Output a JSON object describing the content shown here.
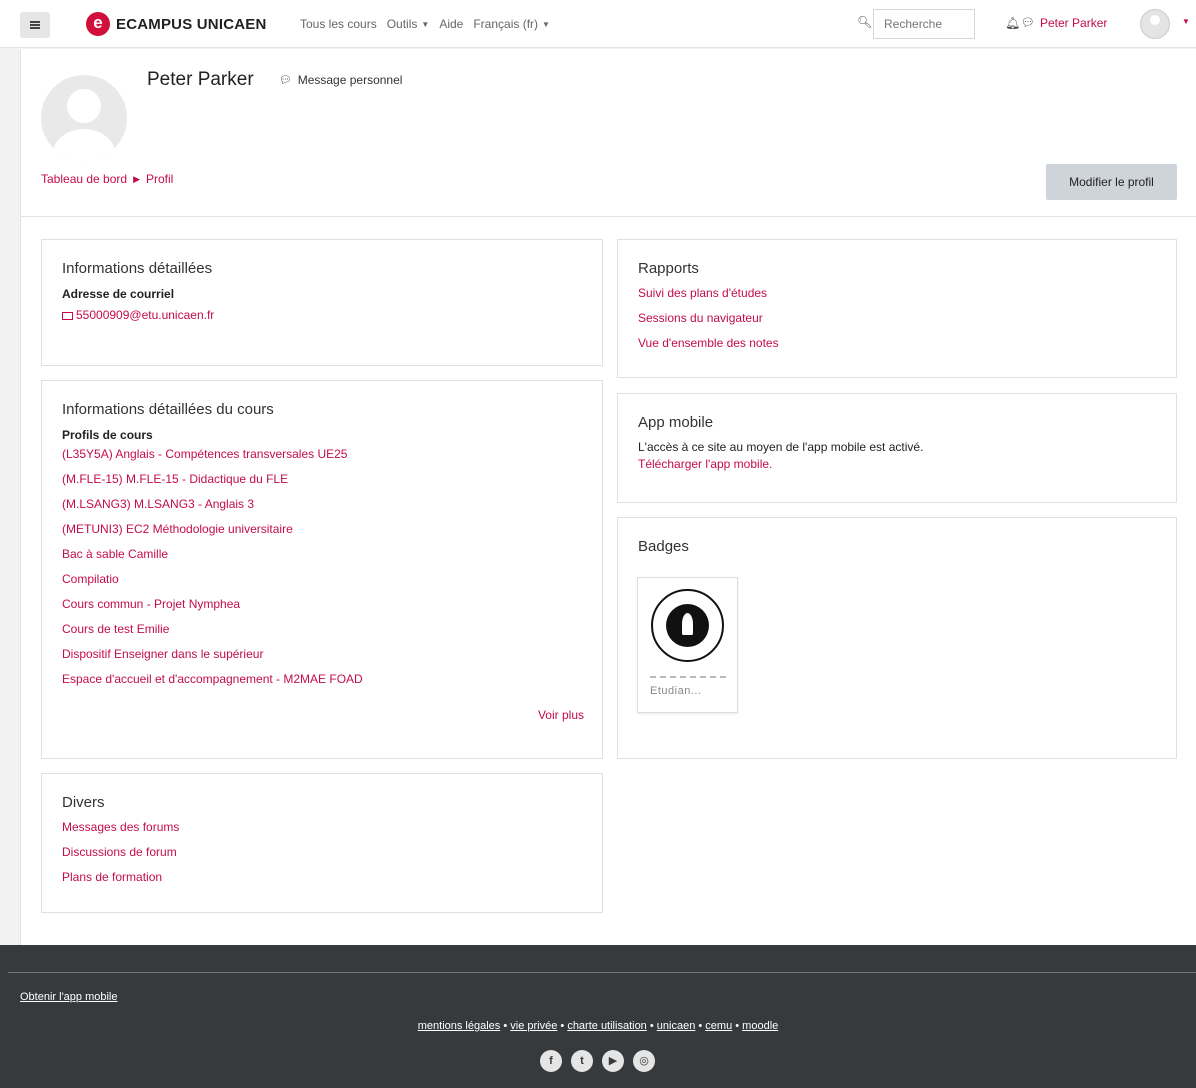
{
  "navbar": {
    "brand": "ECAMPUS UNICAEN",
    "brand_logo": "e",
    "items": [
      "Tous les cours",
      "Outils",
      "Aide",
      "Français (fr)"
    ],
    "search_placeholder": "Recherche",
    "user_name": "Peter Parker"
  },
  "header": {
    "name": "Peter Parker",
    "message_link": "Message personnel",
    "breadcrumb": [
      "Tableau de bord",
      "Profil"
    ],
    "edit_button": "Modifier le profil"
  },
  "info": {
    "title": "Informations détaillées",
    "email_label": "Adresse de courriel",
    "email": "55000909@etu.unicaen.fr"
  },
  "course": {
    "title": "Informations détaillées du cours",
    "label": "Profils de cours",
    "items": [
      "(L35Y5A) Anglais - Compétences transversales UE25",
      "(M.FLE-15) M.FLE-15 - Didactique du FLE",
      "(M.LSANG3) M.LSANG3 - Anglais 3",
      "(METUNI3) EC2 Méthodologie universitaire",
      "Bac à sable Camille",
      "Compilatio",
      "Cours commun - Projet Nymphea",
      "Cours de test Emilie",
      "Dispositif Enseigner dans le supérieur",
      "Espace d'accueil et d'accompagnement - M2MAE FOAD"
    ],
    "see_more": "Voir plus"
  },
  "divers": {
    "title": "Divers",
    "items": [
      "Messages des forums",
      "Discussions de forum",
      "Plans de formation"
    ]
  },
  "reports": {
    "title": "Rapports",
    "items": [
      "Suivi des plans d'études",
      "Sessions du navigateur",
      "Vue d'ensemble des notes"
    ]
  },
  "mobile": {
    "title": "App mobile",
    "text": "L'accès à ce site au moyen de l'app mobile est activé.",
    "link": "Télécharger l'app mobile."
  },
  "badges": {
    "title": "Badges",
    "caption": "Etudian..."
  },
  "footer": {
    "app_link": "Obtenir l'app mobile",
    "links": [
      "mentions légales",
      "vie privée",
      "charte utilisation",
      "unicaen",
      "cemu",
      "moodle"
    ],
    "separator": " • ",
    "social": [
      "facebook-icon",
      "twitter-icon",
      "youtube-icon",
      "instagram-icon"
    ]
  },
  "colors": {
    "accent": "#c40d47",
    "footer_bg": "#373a3c",
    "page_bg": "#f2f2f2"
  }
}
